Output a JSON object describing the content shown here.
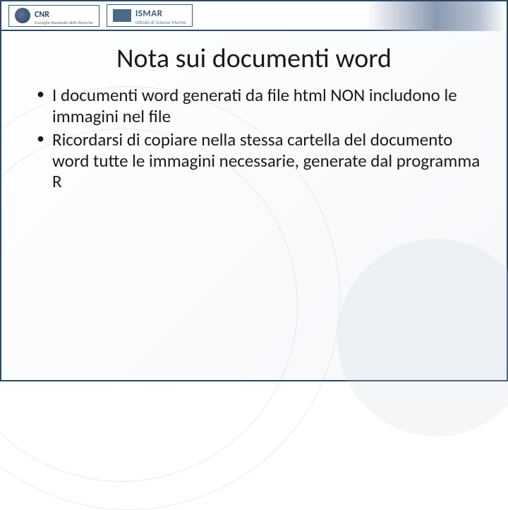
{
  "header": {
    "logo1": {
      "name": "CNR",
      "subtitle": "Consiglio Nazionale delle Ricerche"
    },
    "logo2": {
      "name": "ISMAR",
      "subtitle": "Istituto di Scienze Marine"
    }
  },
  "slide": {
    "title": "Nota sui documenti word",
    "bullets": [
      "I documenti word generati da file html NON includono le immagini nel file",
      "Ricordarsi di copiare nella stessa cartella del documento word tutte le immagini necessarie, generate dal programma R"
    ]
  }
}
